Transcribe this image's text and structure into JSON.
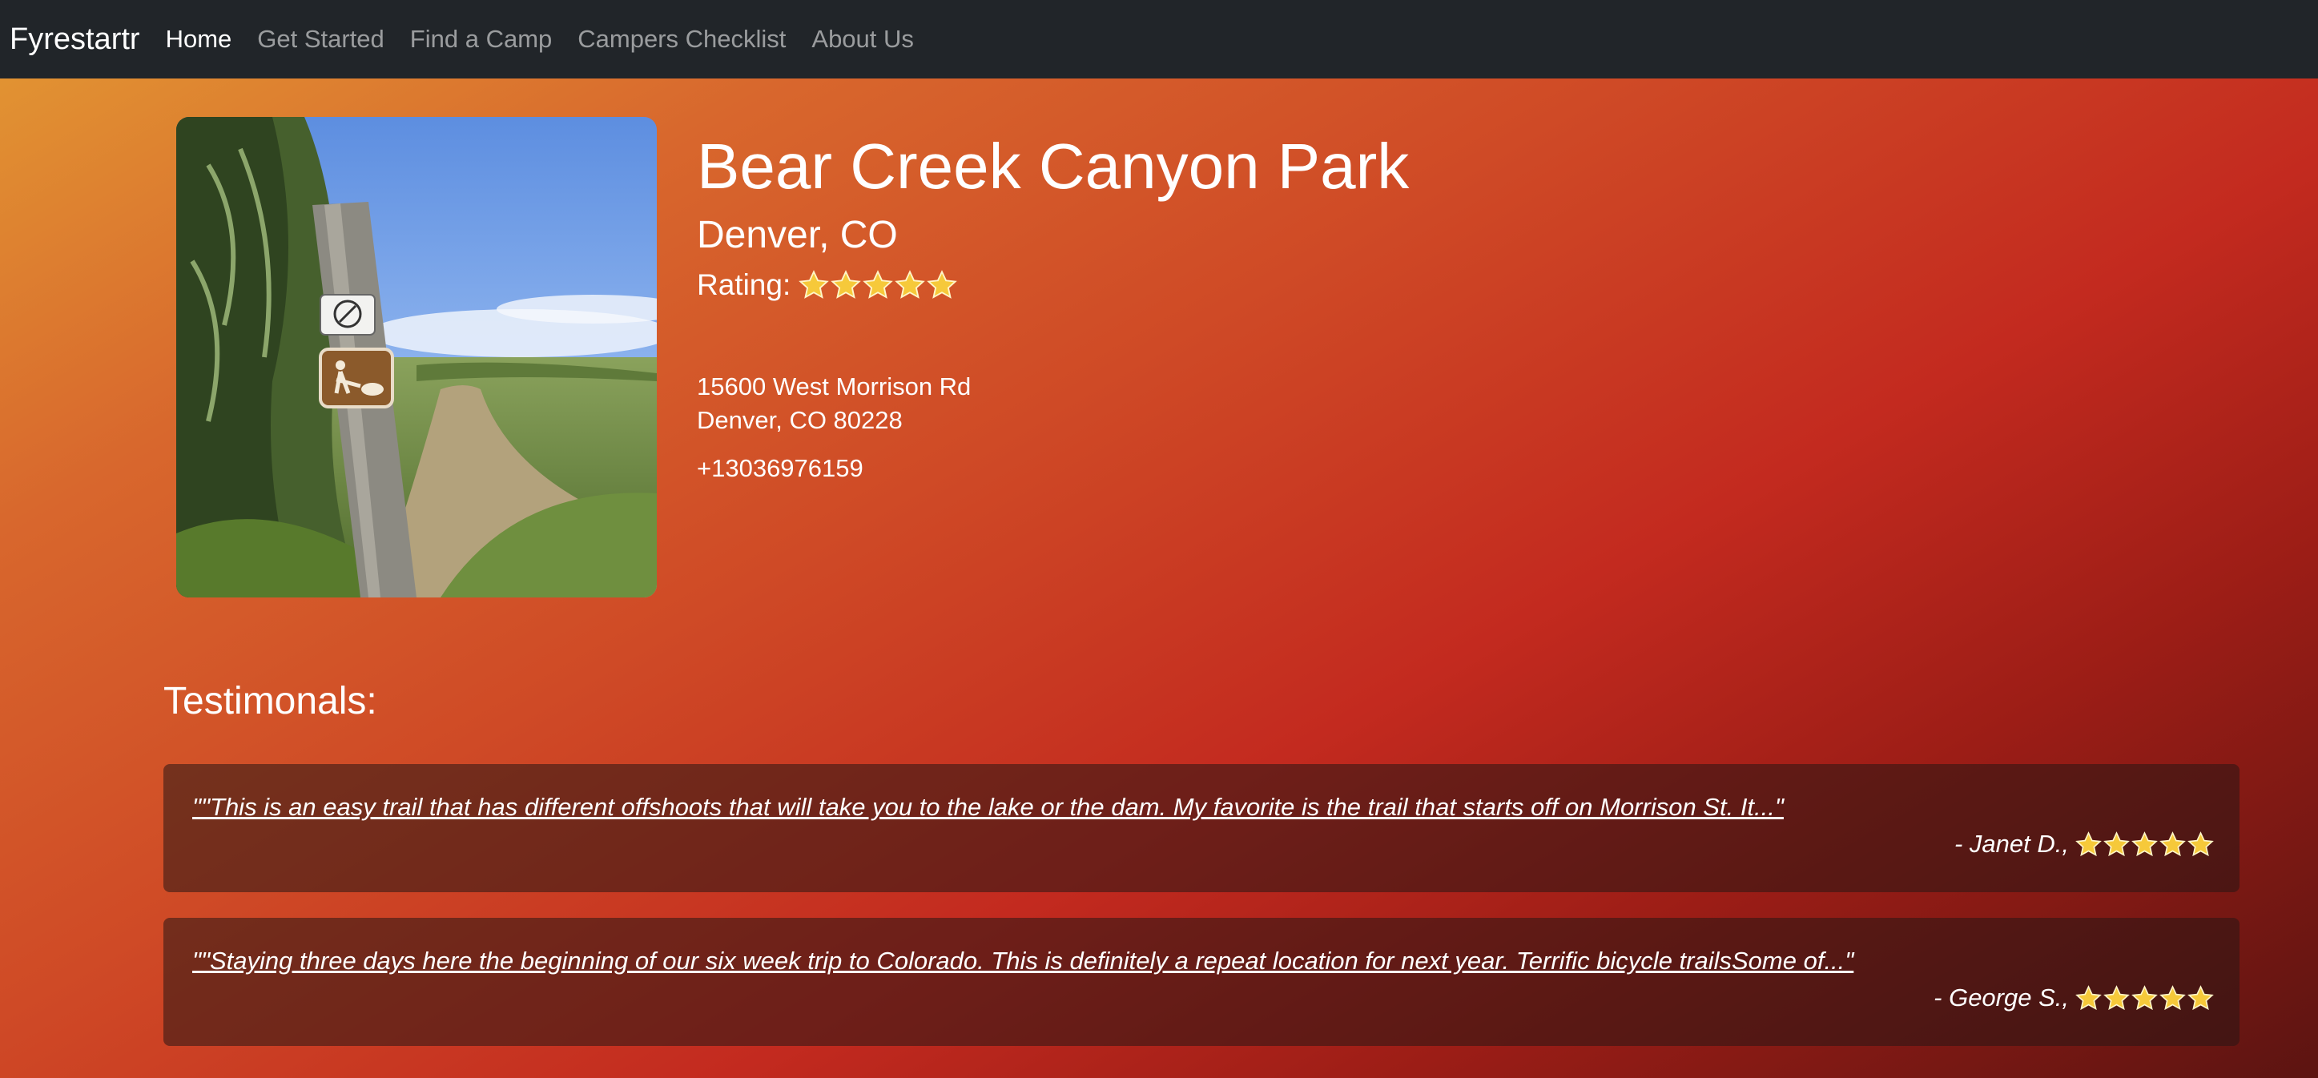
{
  "nav": {
    "brand": "Fyrestartr",
    "links": [
      "Home",
      "Get Started",
      "Find a Camp",
      "Campers Checklist",
      "About Us"
    ]
  },
  "park": {
    "name": "Bear Creek Canyon Park",
    "city": "Denver, CO",
    "rating_label": "Rating:",
    "rating": 5,
    "address_line1": "15600 West Morrison Rd",
    "address_line2": "Denver, CO 80228",
    "phone": "+13036976159",
    "photo_icon": "trail-sign-photo"
  },
  "testimonials": {
    "title": "Testimonals:",
    "items": [
      {
        "quote": "\"\"This is an easy trail that has different offshoots that will take you to the lake or the dam. My favorite is the trail that starts off on Morrison St. It...\"",
        "author": "- Janet D.,",
        "rating": 5
      },
      {
        "quote": "\"\"Staying three days here the beginning of our six week trip to Colorado. This is definitely a repeat location for next year. Terrific bicycle trailsSome of...\"",
        "author": "- George S.,",
        "rating": 5
      }
    ]
  },
  "colors": {
    "navbar": "#212529",
    "star": "#f6c93a"
  }
}
